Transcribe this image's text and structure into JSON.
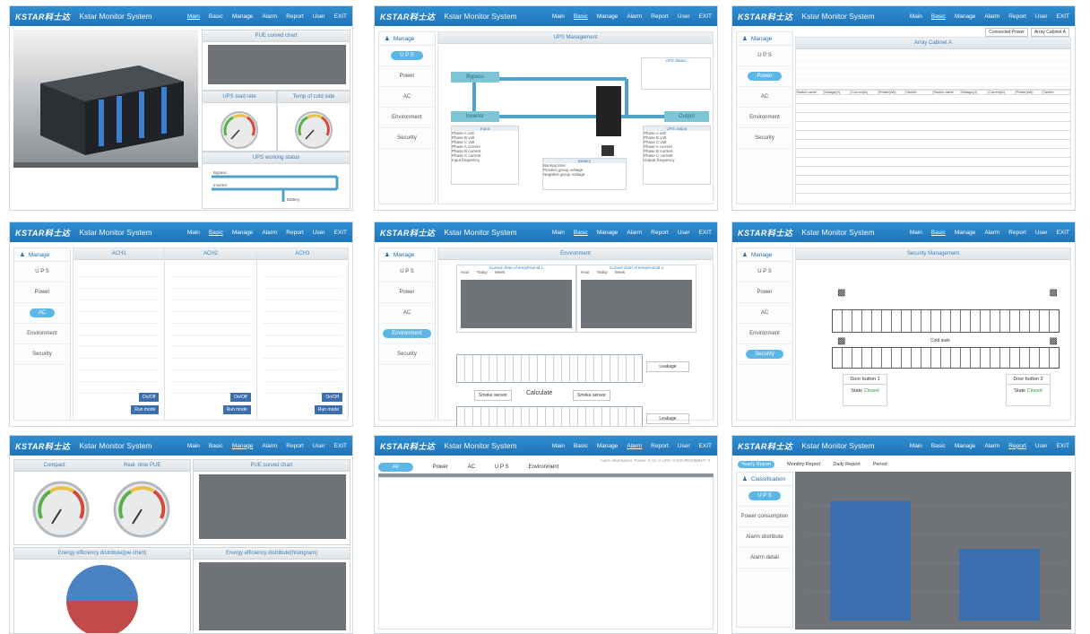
{
  "app": {
    "logo": "KSTAR科士达",
    "title": "Kstar Monitor System",
    "nav": [
      "Main",
      "Basic",
      "Manage",
      "Alarm",
      "Report",
      "User"
    ],
    "exit": "EXIT"
  },
  "sidebar": {
    "head": "Manage",
    "items": [
      "U P S",
      "Power",
      "AC",
      "Environment",
      "Security"
    ]
  },
  "panel_main": {
    "pue_chart": "PUE curved chart",
    "ups_load_rate": "UPS load rate",
    "temp_cold_side": "Temp of cold side",
    "ups_working_status": "UPS working status",
    "flow": [
      "Bypass",
      "Inverter",
      "Battery"
    ]
  },
  "panel_ups": {
    "header": "UPS Management",
    "bypass": "Bypass",
    "inverter": "Inverter",
    "output": "Output",
    "ups_status": "UPS Status",
    "input": "Input",
    "battery": "Battery",
    "ups_output": "UPS output",
    "input_rows": [
      "Phase A volt",
      "Phase B volt",
      "Phase C volt",
      "Phase A current",
      "Phase B current",
      "Phase C current",
      "Input frequency"
    ],
    "output_rows": [
      "Phase A volt",
      "Phase B volt",
      "Phase C volt",
      "Phase A current",
      "Phase B current",
      "Phase C current",
      "Output frequency"
    ],
    "battery_rows": [
      "Backup time",
      "Positive group voltage",
      "Negative group voltage"
    ]
  },
  "panel_power": {
    "tabs": [
      "Connected Power",
      "Array Cabinet A"
    ],
    "header": "Array Cabinet A",
    "columns": [
      "Switch name",
      "Voltage(V)",
      "Current(A)",
      "Power(kW)",
      "Switch",
      "Switch name",
      "Voltage(V)",
      "Current(A)",
      "Power(kW)",
      "Switch"
    ]
  },
  "panel_ac": {
    "units": [
      "ACH1",
      "ACH2",
      "ACH3"
    ],
    "btn_on": "On/Off",
    "btn_run": "Run mode"
  },
  "panel_env": {
    "header": "Environment",
    "chart1": "Curved chart of temp/Humid 1",
    "chart2": "Curved chart of temp/Humid 2",
    "legend": [
      "Hour",
      "Today",
      "Week"
    ],
    "calc": "Calculate",
    "smoke1": "Smoke sensor",
    "smoke2": "Smoke sensor",
    "leakage1": "Leakage",
    "leakage2": "Leakage"
  },
  "panel_security": {
    "header": "Security Management",
    "cold_aisle": "Cold aisle",
    "door1": "Door button 1",
    "door2": "Door button 2",
    "state_label": "State",
    "state_value": "Closed"
  },
  "panel_energy": {
    "compact": "Compact",
    "realtime": "Real- time PUE",
    "pue_chart": "PUE curved chart",
    "pie_title": "Energy efficiency distribute(pie chart)",
    "hist_title": "Energy efficiency distribute(histogram)"
  },
  "panel_alarm": {
    "tabs": [
      "All",
      "Power",
      "AC",
      "U P S",
      "Environment"
    ],
    "info": "Alarm information:  Power: 0   AC: 0   UPS: 0   ENVIRONMENT: 0"
  },
  "panel_report": {
    "tabs": [
      "Yearly Report",
      "Monthly Report",
      "Daily Report",
      "Period"
    ],
    "side_head": "Classification",
    "side_items": [
      "U P S",
      "Power consumption",
      "Alarm distribute",
      "Alarm detail"
    ]
  },
  "colors": {
    "topbar": "#1f74b8",
    "accent": "#5cb6e6",
    "chart_bg": "#6f7377",
    "pie_top": "#4a82c2",
    "pie_bottom": "#c24a4a",
    "bar": "#3a6fb0",
    "green": "#3a9a3a"
  },
  "chart_data": {
    "type": "bar",
    "categories": [
      "",
      ""
    ],
    "values": [
      100,
      60
    ],
    "ylim": [
      0,
      120
    ]
  }
}
